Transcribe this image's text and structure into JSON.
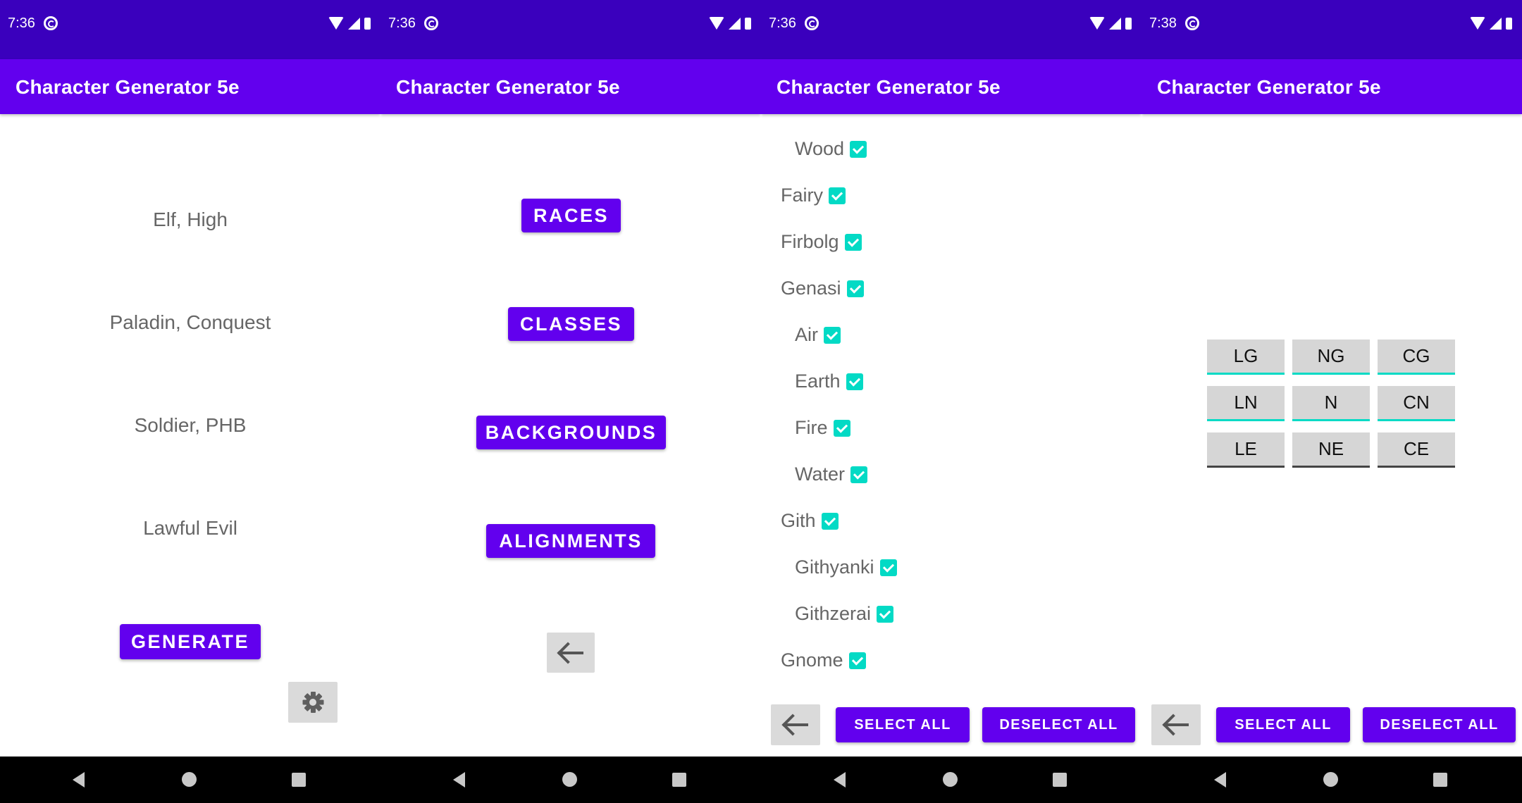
{
  "app_title": "Character Generator 5e",
  "screens": [
    {
      "time": "7:36",
      "results": [
        "Elf, High",
        "Paladin, Conquest",
        "Soldier, PHB",
        "Lawful Evil"
      ],
      "generate_label": "GENERATE"
    },
    {
      "time": "7:36",
      "menu": [
        "RACES",
        "CLASSES",
        "BACKGROUNDS",
        "ALIGNMENTS"
      ]
    },
    {
      "time": "7:36",
      "races": [
        {
          "label": "Wood",
          "sub": true,
          "checked": true
        },
        {
          "label": "Fairy",
          "sub": false,
          "checked": true
        },
        {
          "label": "Firbolg",
          "sub": false,
          "checked": true
        },
        {
          "label": "Genasi",
          "sub": false,
          "checked": true
        },
        {
          "label": "Air",
          "sub": true,
          "checked": true
        },
        {
          "label": "Earth",
          "sub": true,
          "checked": true
        },
        {
          "label": "Fire",
          "sub": true,
          "checked": true
        },
        {
          "label": "Water",
          "sub": true,
          "checked": true
        },
        {
          "label": "Gith",
          "sub": false,
          "checked": true
        },
        {
          "label": "Githyanki",
          "sub": true,
          "checked": true
        },
        {
          "label": "Githzerai",
          "sub": true,
          "checked": true
        },
        {
          "label": "Gnome",
          "sub": false,
          "checked": true
        }
      ],
      "select_all": "SELECT ALL",
      "deselect_all": "DESELECT ALL"
    },
    {
      "time": "7:38",
      "alignments": [
        {
          "label": "LG",
          "selected": true
        },
        {
          "label": "NG",
          "selected": true
        },
        {
          "label": "CG",
          "selected": true
        },
        {
          "label": "LN",
          "selected": true
        },
        {
          "label": "N",
          "selected": true
        },
        {
          "label": "CN",
          "selected": true
        },
        {
          "label": "LE",
          "selected": false
        },
        {
          "label": "NE",
          "selected": false
        },
        {
          "label": "CE",
          "selected": false
        }
      ],
      "select_all": "SELECT ALL",
      "deselect_all": "DESELECT ALL"
    }
  ],
  "icons": {
    "dnd": "do-not-disturb-icon",
    "wifi": "wifi-icon",
    "signal": "cell-signal-icon",
    "battery": "battery-icon",
    "back": "arrow-back-icon",
    "settings": "gear-icon",
    "nav_back": "nav-back-icon",
    "nav_home": "nav-home-icon",
    "nav_recent": "nav-recents-icon"
  },
  "colors": {
    "status_bar": "#3a00bd",
    "app_bar": "#6200ee",
    "button": "#6200ee",
    "checkbox": "#03dac5",
    "secondary_button": "#dadada"
  }
}
